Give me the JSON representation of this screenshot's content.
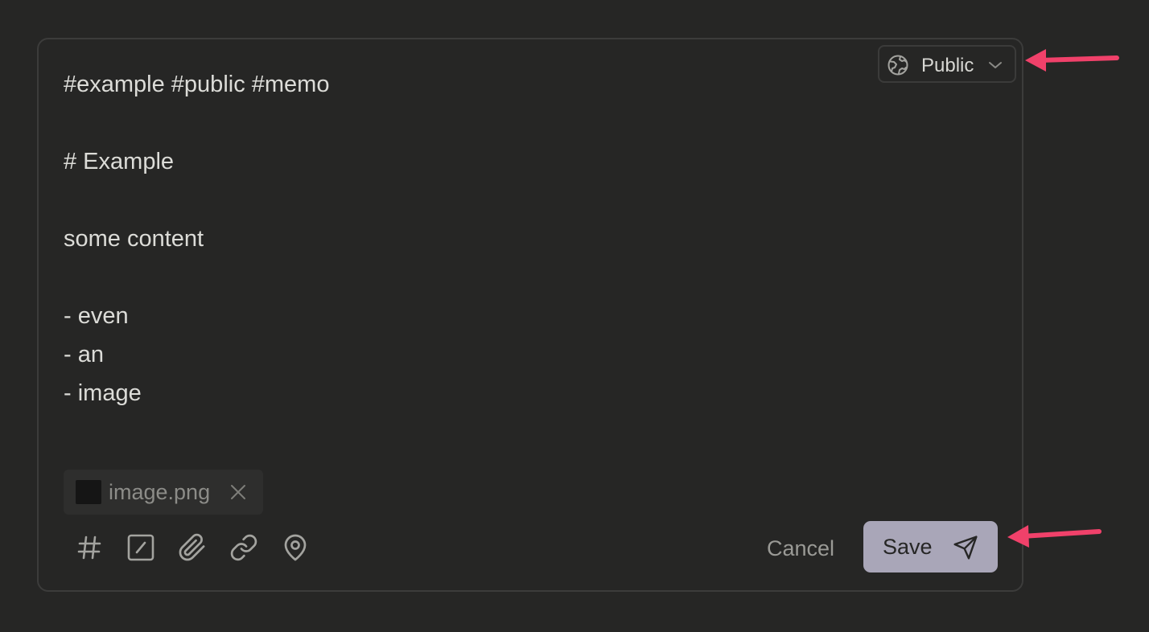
{
  "visibility": {
    "icon": "globe-icon",
    "label": "Public",
    "dropdown_icon": "chevron-down-icon"
  },
  "content": {
    "lines": [
      "#example #public #memo",
      "",
      "# Example",
      "",
      "some content",
      "",
      "- even",
      "- an",
      "- image"
    ]
  },
  "attachment": {
    "filename": "image.png",
    "remove_icon": "close-icon"
  },
  "toolbar": {
    "tools": [
      "hashtag-icon",
      "checkbox-icon",
      "paperclip-icon",
      "link-icon",
      "map-pin-icon"
    ]
  },
  "actions": {
    "cancel_label": "Cancel",
    "save_label": "Save",
    "save_icon": "send-icon"
  },
  "colors": {
    "background": "#262625",
    "border": "#3c3c3b",
    "text": "#dcdcd8",
    "muted_text": "#9a9a96",
    "save_button": "#a9a6b8",
    "annotation_arrow": "#f0416a"
  }
}
